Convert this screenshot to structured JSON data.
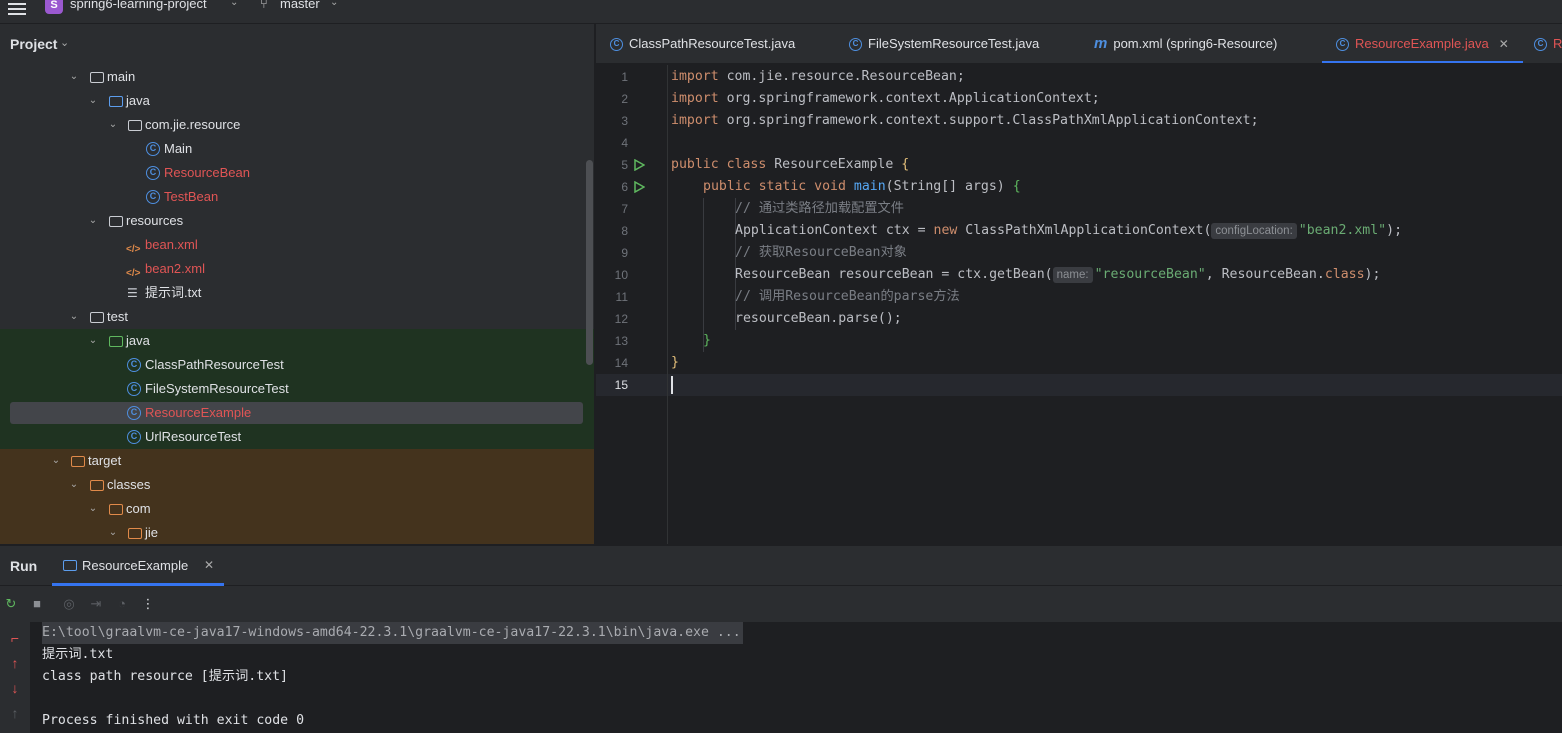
{
  "titlebar": {
    "project_badge": "S",
    "project_name": "spring6-learning-project",
    "branch": "master"
  },
  "project_panel": {
    "title": "Project",
    "tree": [
      {
        "label": "main",
        "type": "folder",
        "color": "plain"
      },
      {
        "label": "java",
        "type": "folder",
        "color": "blue"
      },
      {
        "label": "com.jie.resource",
        "type": "package"
      },
      {
        "label": "Main",
        "type": "class"
      },
      {
        "label": "ResourceBean",
        "type": "class",
        "modified": true
      },
      {
        "label": "TestBean",
        "type": "class",
        "modified": true
      },
      {
        "label": "resources",
        "type": "folder",
        "color": "resources"
      },
      {
        "label": "bean.xml",
        "type": "xml",
        "modified": true
      },
      {
        "label": "bean2.xml",
        "type": "xml",
        "modified": true
      },
      {
        "label": "提示词.txt",
        "type": "txt"
      },
      {
        "label": "test",
        "type": "folder",
        "color": "plain"
      },
      {
        "label": "java",
        "type": "folder",
        "color": "green"
      },
      {
        "label": "ClassPathResourceTest",
        "type": "class"
      },
      {
        "label": "FileSystemResourceTest",
        "type": "class"
      },
      {
        "label": "ResourceExample",
        "type": "class",
        "modified": true,
        "selected": true
      },
      {
        "label": "UrlResourceTest",
        "type": "class"
      },
      {
        "label": "target",
        "type": "folder",
        "color": "orange"
      },
      {
        "label": "classes",
        "type": "folder",
        "color": "orange"
      },
      {
        "label": "com",
        "type": "folder",
        "color": "orange"
      },
      {
        "label": "jie",
        "type": "folder",
        "color": "orange"
      }
    ]
  },
  "editor_tabs": [
    {
      "label": "ClassPathResourceTest.java",
      "icon": "class-icon"
    },
    {
      "label": "FileSystemResourceTest.java",
      "icon": "class-icon"
    },
    {
      "label": "pom.xml (spring6-Resource)",
      "icon": "maven-icon"
    },
    {
      "label": "ResourceExample.java",
      "icon": "class-icon",
      "active": true
    },
    {
      "label": "R",
      "icon": "class-icon"
    }
  ],
  "editor": {
    "line_numbers": [
      "1",
      "2",
      "3",
      "4",
      "5",
      "6",
      "7",
      "8",
      "9",
      "10",
      "11",
      "12",
      "13",
      "14",
      "15"
    ],
    "lines": {
      "l1_kw": "import",
      "l1_rest": " com.jie.resource.ResourceBean;",
      "l2_kw": "import",
      "l2_rest": " org.springframework.context.ApplicationContext;",
      "l3_kw": "import",
      "l3_rest": " org.springframework.context.support.ClassPathXmlApplicationContext;",
      "l5_kw": "public class",
      "l5_rest": " ResourceExample ",
      "l5_brace": "{",
      "l6_kw": "public static void",
      "l6_fn": "main",
      "l6_rest": "(String[] args) ",
      "l6_brace": "{",
      "l7_cmt": "// 通过类路径加载配置文件",
      "l8_a": "ApplicationContext ctx = ",
      "l8_kw": "new",
      "l8_b": " ClassPathXmlApplicationContext(",
      "l8_hint": "configLocation:",
      "l8_str": "\"bean2.xml\"",
      "l8_c": ");",
      "l9_cmt": "// 获取ResourceBean对象",
      "l10_a": "ResourceBean resourceBean = ctx.getBean(",
      "l10_hint": "name:",
      "l10_str": "\"resourceBean\"",
      "l10_b": ", ResourceBean.",
      "l10_kw": "class",
      "l10_c": ");",
      "l11_cmt": "// 调用ResourceBean的parse方法",
      "l12": "resourceBean.parse();",
      "l13": "}",
      "l14": "}"
    }
  },
  "run_panel": {
    "title": "Run",
    "tab_label": "ResourceExample",
    "console": [
      "E:\\tool\\graalvm-ce-java17-windows-amd64-22.3.1\\graalvm-ce-java17-22.3.1\\bin\\java.exe ...",
      "提示词.txt",
      "class path resource [提示词.txt]",
      "",
      "Process finished with exit code 0"
    ]
  },
  "colors": {
    "accent": "#3574f0",
    "modified_file": "#e05555",
    "keyword": "#cf8e6d",
    "string": "#6aab73",
    "comment": "#7a7e85",
    "method": "#56a8f5"
  }
}
